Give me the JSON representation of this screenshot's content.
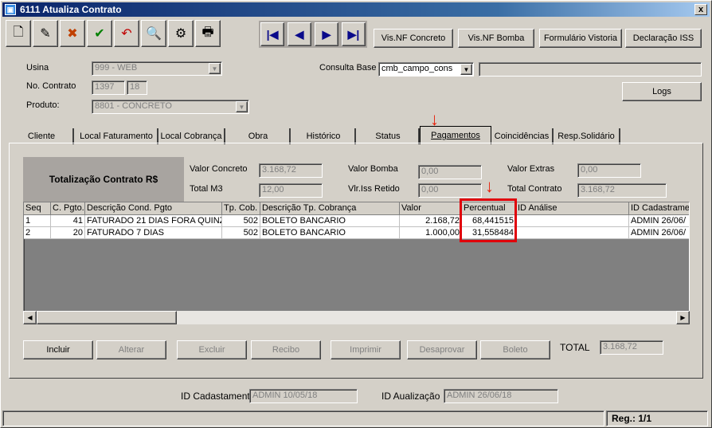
{
  "window": {
    "title": "6111 Atualiza Contrato",
    "close": "x"
  },
  "toolbar": {
    "icons": [
      "new-icon",
      "edit-icon",
      "delete-icon",
      "confirm-icon",
      "undo-icon",
      "find-icon",
      "print-preview-icon",
      "print-icon"
    ],
    "glyphs": [
      "🗋",
      "✎",
      "✖",
      "✔",
      "↶",
      "🔍",
      "⚙",
      "🖶"
    ],
    "nav": [
      "|◀",
      "◀",
      "▶",
      "▶|"
    ],
    "buttons": [
      "Vis.NF Concreto",
      "Vis.NF Bomba",
      "Formulário Vistoria",
      "Declaração ISS"
    ]
  },
  "header": {
    "usina_label": "Usina",
    "usina_value": "999 - WEB",
    "contrato_label": "No. Contrato",
    "contrato_value": "1397",
    "contrato_seq": "18",
    "produto_label": "Produto:",
    "produto_value": "8801 - CONCRETO",
    "consulta_label": "Consulta Base",
    "consulta_value": "cmb_campo_cons",
    "consulta_extra": "",
    "logs_button": "Logs"
  },
  "tabs": [
    "Cliente",
    "Local Faturamento",
    "Local Cobrança",
    "Obra",
    "Histórico",
    "Status",
    "Pagamentos",
    "Coincidências",
    "Resp.Solidário"
  ],
  "active_tab": "Pagamentos",
  "totals": {
    "box_title": "Totalização Contrato R$",
    "valor_concreto_label": "Valor Concreto",
    "valor_concreto": "3.168,72",
    "total_m3_label": "Total M3",
    "total_m3": "12,00",
    "valor_bomba_label": "Valor Bomba",
    "valor_bomba": "0,00",
    "vlr_iss_label": "Vlr.Iss Retido",
    "vlr_iss": "0,00",
    "valor_extras_label": "Valor Extras",
    "valor_extras": "0,00",
    "total_contrato_label": "Total Contrato",
    "total_contrato": "3.168,72"
  },
  "grid": {
    "columns": [
      "Seq",
      "C. Pgto.",
      "Descrição Cond. Pgto",
      "Tp. Cob.",
      "Descrição Tp. Cobrança",
      "Valor",
      "Percentual",
      "ID Análise",
      "ID Cadastrame"
    ],
    "rows": [
      [
        "1",
        "41",
        "FATURADO 21 DIAS FORA QUINZ",
        "502",
        "BOLETO BANCARIO",
        "2.168,72",
        "68,441515",
        "",
        "ADMIN 26/06/"
      ],
      [
        "2",
        "20",
        "FATURADO 7 DIAS",
        "502",
        "BOLETO BANCARIO",
        "1.000,00",
        "31,558484",
        "",
        "ADMIN 26/06/"
      ]
    ]
  },
  "actions": [
    "Incluir",
    "Alterar",
    "Excluir",
    "Recibo",
    "Imprimir",
    "Desaprovar",
    "Boleto"
  ],
  "total_label": "TOTAL",
  "total_value": "3.168,72",
  "footer": {
    "id_cad_label": "ID Cadastamento",
    "id_cad_value": "ADMIN 10/05/18",
    "id_atu_label": "ID Aualização",
    "id_atu_value": "ADMIN 26/06/18"
  },
  "status": {
    "reg": "Reg.: 1/1"
  },
  "colors": {
    "highlight": "#e0000a",
    "title_bar": "#0a246a"
  }
}
